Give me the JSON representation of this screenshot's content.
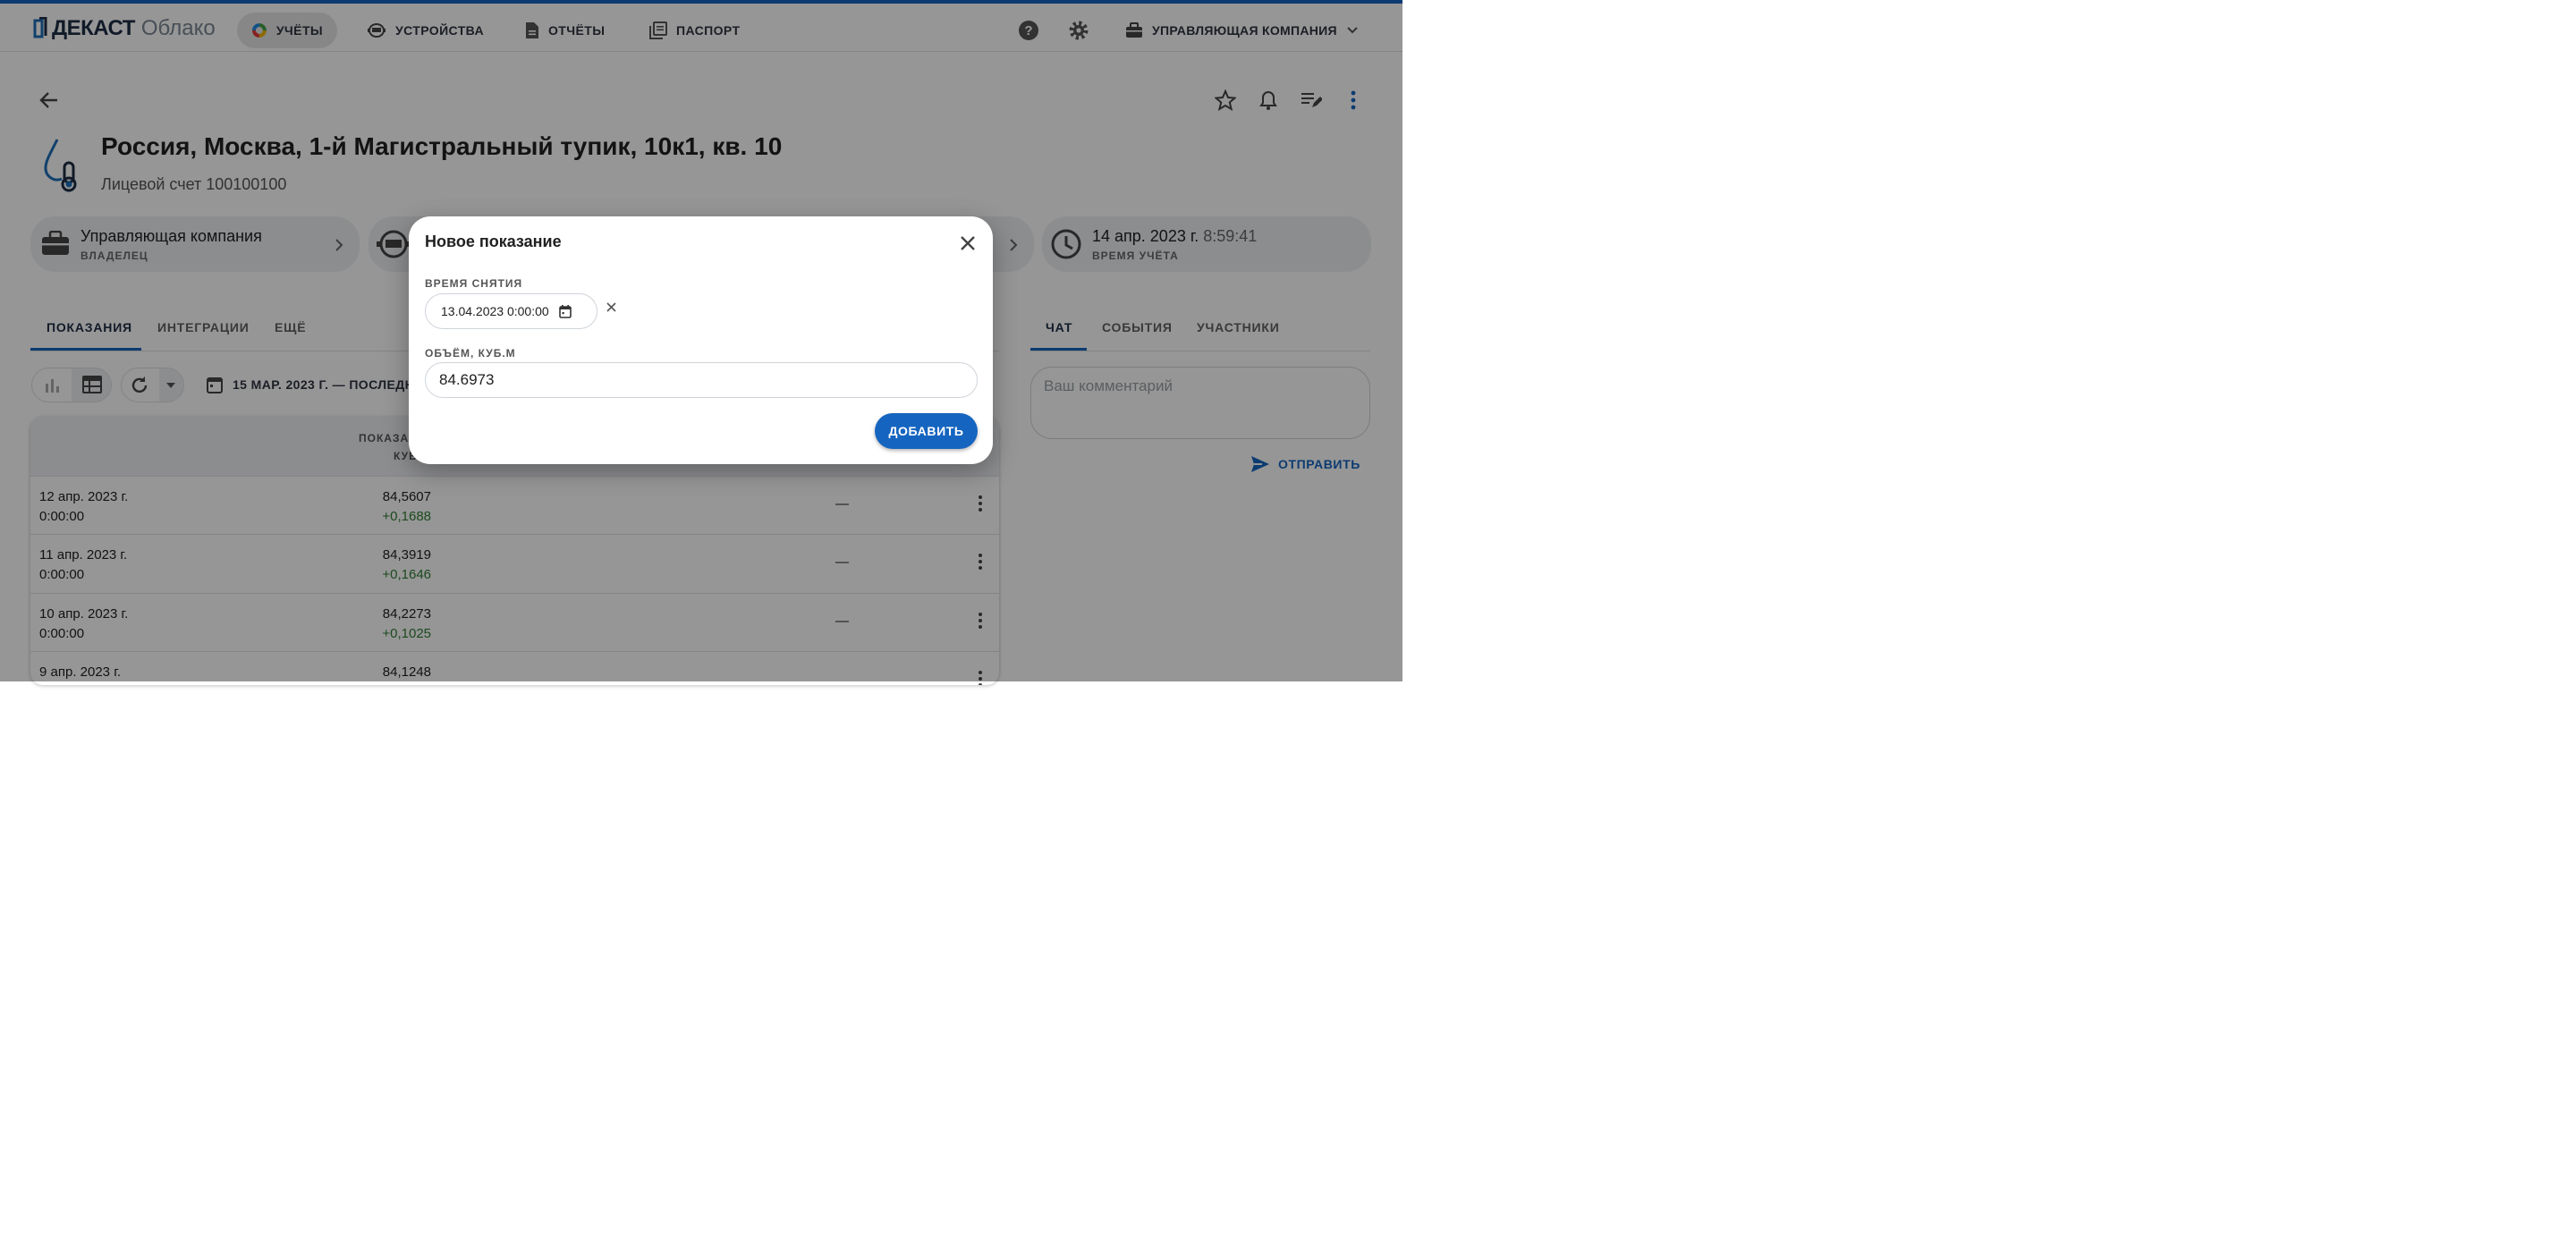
{
  "app": {
    "logo": "ДЕКАСТ",
    "logo_sub": "Облако"
  },
  "nav": [
    {
      "label": "УЧЁТЫ",
      "icon": "pie-chart-icon",
      "active": true
    },
    {
      "label": "УСТРОЙСТВА",
      "icon": "meter-device-icon",
      "active": false
    },
    {
      "label": "ОТЧЁТЫ",
      "icon": "document-icon",
      "active": false
    },
    {
      "label": "ПАСПОРТ",
      "icon": "library-books-icon",
      "active": false
    }
  ],
  "header": {
    "help_icon": "help-circle-icon",
    "settings_icon": "gear-icon",
    "company": "УПРАВЛЯЮЩАЯ КОМПАНИЯ"
  },
  "page": {
    "title": "Россия, Москва, 1-й Магистральный тупик, 10к1, кв. 10",
    "subtitle": "Лицевой счет 100100100",
    "actions": [
      "star-icon",
      "bell-icon",
      "edit-list-icon",
      "more-vertical-icon"
    ]
  },
  "cards": {
    "owner_title": "Управляющая компания",
    "owner_sub": "ВЛАДЕЛЕЦ",
    "time_date": "14 апр. 2023 г.",
    "time_clock": "8:59:41",
    "time_sub": "ВРЕМЯ УЧЁТА"
  },
  "tabs": {
    "readings": "ПОКАЗАНИЯ",
    "integrations": "ИНТЕГРАЦИИ",
    "more": "ЕЩЁ"
  },
  "toolbar": {
    "date_range": "15 МАР. 2023 Г. — ПОСЛЕДН"
  },
  "table": {
    "header_col": "ПОКАЗА",
    "header_col2": "КУБ",
    "rows": [
      {
        "date": "12 апр. 2023 г.",
        "time": "0:00:00",
        "value": "84,5607",
        "delta": "+0,1688",
        "extra": "—"
      },
      {
        "date": "11 апр. 2023 г.",
        "time": "0:00:00",
        "value": "84,3919",
        "delta": "+0,1646",
        "extra": "—"
      },
      {
        "date": "10 апр. 2023 г.",
        "time": "0:00:00",
        "value": "84,2273",
        "delta": "+0,1025",
        "extra": "—"
      },
      {
        "date": "9 апр. 2023 г.",
        "time": "",
        "value": "84,1248",
        "delta": "",
        "extra": ""
      }
    ]
  },
  "side": {
    "tabs": [
      "ЧАТ",
      "СОБЫТИЯ",
      "УЧАСТНИКИ"
    ],
    "comment_placeholder": "Ваш комментарий",
    "send_label": "ОТПРАВИТЬ"
  },
  "dialog": {
    "title": "Новое показание",
    "time_label": "ВРЕМЯ СНЯТИЯ",
    "time_value": "13.04.2023 0:00:00",
    "volume_label": "ОБЪЁМ, КУБ.М",
    "volume_value": "84.6973",
    "add_label": "ДОБАВИТЬ"
  },
  "colors": {
    "brand": "#1565c0",
    "delta": "#2e7d32",
    "overlay": "rgba(0,0,0,0.41)"
  }
}
